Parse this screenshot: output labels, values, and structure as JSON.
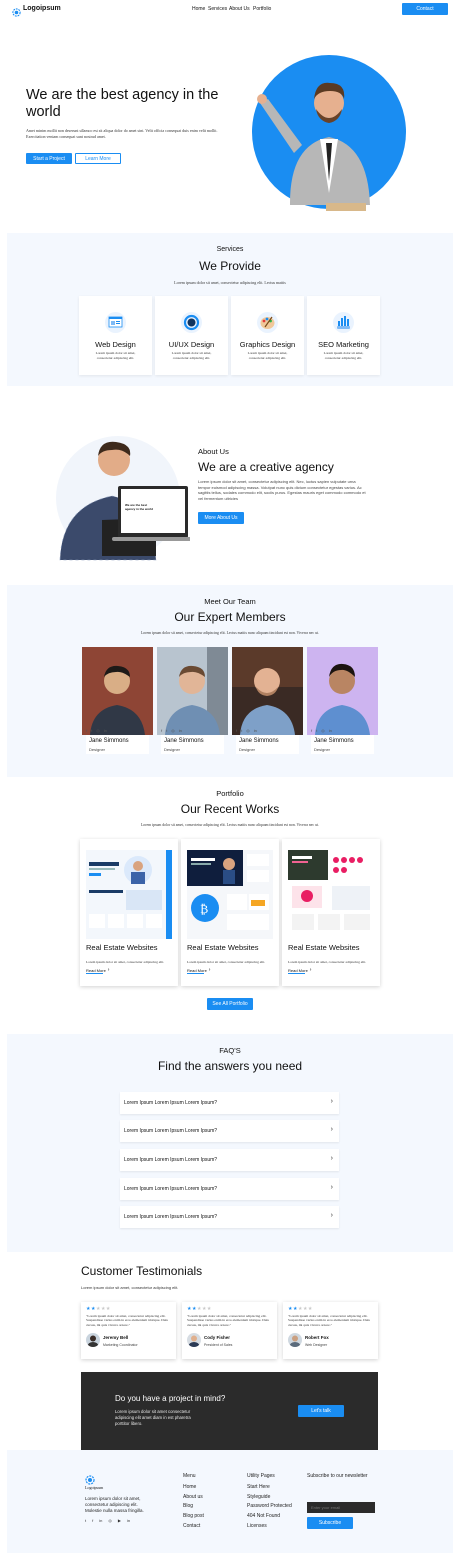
{
  "nav": {
    "logo_text": "Logoipsum",
    "links": [
      "Home",
      "Services",
      "About Us",
      "Portfolio"
    ],
    "contact_label": "Contact"
  },
  "hero": {
    "title": "We are the best agency in the world",
    "text": "Amet minim mollit non deserunt ullamco est sit aliqua dolor do amet sint. Velit officia consequat duis enim velit mollit. Exercitation veniam consequat sunt nostrud amet.",
    "primary_label": "Start a Project",
    "secondary_label": "Learn More"
  },
  "services": {
    "eyebrow": "Services",
    "title": "We Provide",
    "subtitle": "Lorem ipsum dolor sit amet, consectetur adipiscing elit. Lectus mattis",
    "items": [
      {
        "name": "Web Design",
        "text": "Lorem ipsum dolor sit amet, consectetur adipiscing elit.",
        "icon": "web-design-icon"
      },
      {
        "name": "UI/UX Design",
        "text": "Lorem ipsum dolor sit amet, consectetur adipiscing elit.",
        "icon": "uiux-design-icon"
      },
      {
        "name": "Graphics Design",
        "text": "Lorem ipsum dolor sit amet, consectetur adipiscing elit.",
        "icon": "graphics-design-icon"
      },
      {
        "name": "SEO Marketing",
        "text": "Lorem ipsum dolor sit amet, consectetur adipiscing elit.",
        "icon": "seo-marketing-icon"
      }
    ]
  },
  "about": {
    "eyebrow": "About Us",
    "title": "We are a creative agency",
    "text": "Lorem ipsum dolor sit amet, consectetur adipiscing elit. Nec, luctus sapien vulputate urna tempor euismod adipiscing massa. Volutpat nunc quis dictum consectetur egestas varius. Ac sagittis tellus, sodales commodo elit, sociis purus. Egestas mauris eget commodo commodo et vel fermentum ultricies",
    "button_label": "More About Us",
    "laptop_headline": "We are the best agency in the world"
  },
  "team": {
    "eyebrow": "Meet Our Team",
    "title": "Our Expert Members",
    "subtitle": "Lorem ipsum dolor sit amet, consectetur adipiscing elit. Lectus mattis nunc aliquam tincidunt est non. Viverra nec ut.",
    "members": [
      {
        "name": "Jane Simmons",
        "role": "Designer"
      },
      {
        "name": "Jane Simmons",
        "role": "Designer"
      },
      {
        "name": "Jane Simmons",
        "role": "Designer"
      },
      {
        "name": "Jane Simmons",
        "role": "Designer"
      }
    ]
  },
  "portfolio": {
    "eyebrow": "Portfolio",
    "title": "Our Recent Works",
    "subtitle": "Lorem ipsum dolor sit amet, consectetur adipiscing elit. Lectus mattis nunc aliquam tincidunt est non. Viverra nec ut.",
    "items": [
      {
        "title": "Real Estate Websites",
        "text": "Lorem ipsum dolor sit amet, consectetur adipiscing elit.",
        "link": "Read More"
      },
      {
        "title": "Real Estate Websites",
        "text": "Lorem ipsum dolor sit amet, consectetur adipiscing elit.",
        "link": "Read More"
      },
      {
        "title": "Real Estate Websites",
        "text": "Lorem ipsum dolor sit amet, consectetur adipiscing elit.",
        "link": "Read More"
      }
    ],
    "button_label": "See All Portfolio"
  },
  "faq": {
    "eyebrow": "FAQ'S",
    "title": "Find the answers you need",
    "questions": [
      "Lorem Ipsum Lorem Ipsum Lorem Ipsum?",
      "Lorem Ipsum Lorem Ipsum Lorem Ipsum?",
      "Lorem Ipsum Lorem Ipsum Lorem Ipsum?",
      "Lorem Ipsum Lorem Ipsum Lorem Ipsum?",
      "Lorem Ipsum Lorem Ipsum Lorem Ipsum?"
    ]
  },
  "testimonials": {
    "title": "Customer Testimonials",
    "subtitle": "Lorem ipsum dolor sit amet, consectetur adipiscing elit.",
    "items": [
      {
        "quote": "\"Lorem ipsum dolor sit amet, consectetur adipiscing elit. Suspendisse varius enim in eros elementum tristique. Duis cursus, mi quis viverra ornare.\"",
        "name": "Jeremy Bell",
        "role": "Marketing Coordinator",
        "rating": 1.5
      },
      {
        "quote": "\"Lorem ipsum dolor sit amet, consectetur adipiscing elit. Suspendisse varius enim in eros elementum tristique. Duis cursus, mi quis viverra ornare.\"",
        "name": "Cody Fisher",
        "role": "President of Sales",
        "rating": 1.5
      },
      {
        "quote": "\"Lorem ipsum dolor sit amet, consectetur adipiscing elit. Suspendisse varius enim in eros elementum tristique. Duis cursus, mi quis viverra ornare.\"",
        "name": "Robert Fox",
        "role": "Web Designer",
        "rating": 1.5
      }
    ]
  },
  "cta": {
    "title": "Do you have a project in mind?",
    "text": "Lorem ipsum dolor sit amet consectetur adipiscing elit amet diam in est pharetra porttitor libero.",
    "button_label": "Let's talk"
  },
  "footer": {
    "logo_text": "Logoipsum",
    "about_text": "Lorem ipsum dolor sit amet, consectetur adipiscing elit. Molestie nulla massa fringilla.",
    "menu_title": "Menu",
    "menu_links": [
      "Home",
      "About us",
      "Blog",
      "Blog post",
      "Contact"
    ],
    "utility_title": "Utility Pages",
    "utility_links": [
      "Start Here",
      "Styleguide",
      "Password Protected",
      "404 Not Found",
      "Licenses"
    ],
    "newsletter_title": "Subscribe to our newsletter",
    "email_placeholder": "Enter your email",
    "subscribe_label": "Subscribe"
  },
  "colors": {
    "accent": "#1a8df2",
    "dark": "#2b2b2b",
    "section_bg": "#f4f8fe"
  }
}
